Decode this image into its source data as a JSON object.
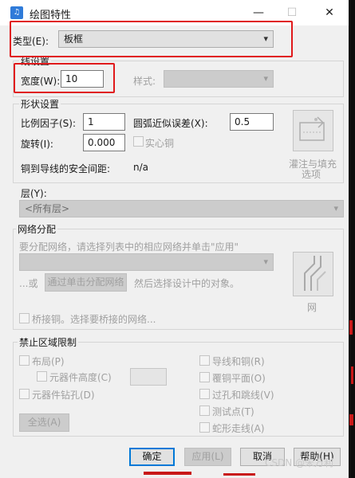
{
  "window": {
    "title": "绘图特性",
    "app_icon_glyph": "♫",
    "minimize_glyph": "—",
    "maximize_glyph": "☐",
    "close_glyph": "✕"
  },
  "type_row": {
    "label": "类型(E):",
    "value": "板框"
  },
  "line_settings": {
    "label": "线设置",
    "width_label": "宽度(W):",
    "width_value": "10",
    "style_label": "样式:"
  },
  "shape_settings": {
    "label": "形状设置",
    "ratio_label": "比例因子(S):",
    "ratio_value": "1",
    "arc_label": "圆弧近似误差(X):",
    "arc_value": "0.5",
    "rotation_label": "旋转(I):",
    "rotation_value": "0.000",
    "solid_copper_label": "实心铜",
    "clearance_label": "铜到导线的安全间距:",
    "clearance_value": "n/a",
    "fill_button_label_line1": "灌注与填充",
    "fill_button_label_line2": "选项"
  },
  "layer": {
    "label": "层(Y):",
    "value": "<所有层>"
  },
  "net_assign": {
    "label": "网络分配",
    "hint": "要分配网络，请选择列表中的相应网络并单击\"应用\"",
    "or_text": "...或",
    "click_assign_button": "通过单击分配网络",
    "then_text": "然后选择设计中的对象。",
    "net_button_label": "网",
    "bridge_copper_label": "桥接铜。选择要桥接的网络..."
  },
  "keepout": {
    "label": "禁止区域限制",
    "left_items": [
      "布局(P)",
      "元器件高度(C)",
      "元器件钻孔(D)"
    ],
    "right_items": [
      "导线和铜(R)",
      "覆铜平面(O)",
      "过孔和跳线(V)",
      "测试点(T)",
      "蛇形走线(A)"
    ],
    "select_all": "全选(A)"
  },
  "footer": {
    "ok": "确定",
    "cancel": "取消",
    "apply": "应用(L)",
    "help": "帮助(H)"
  },
  "watermark": "CSDN @宋万利",
  "colors": {
    "highlight": "#e0191b",
    "accent": "#0078d7",
    "dialog_bg": "#f0f0f0"
  }
}
